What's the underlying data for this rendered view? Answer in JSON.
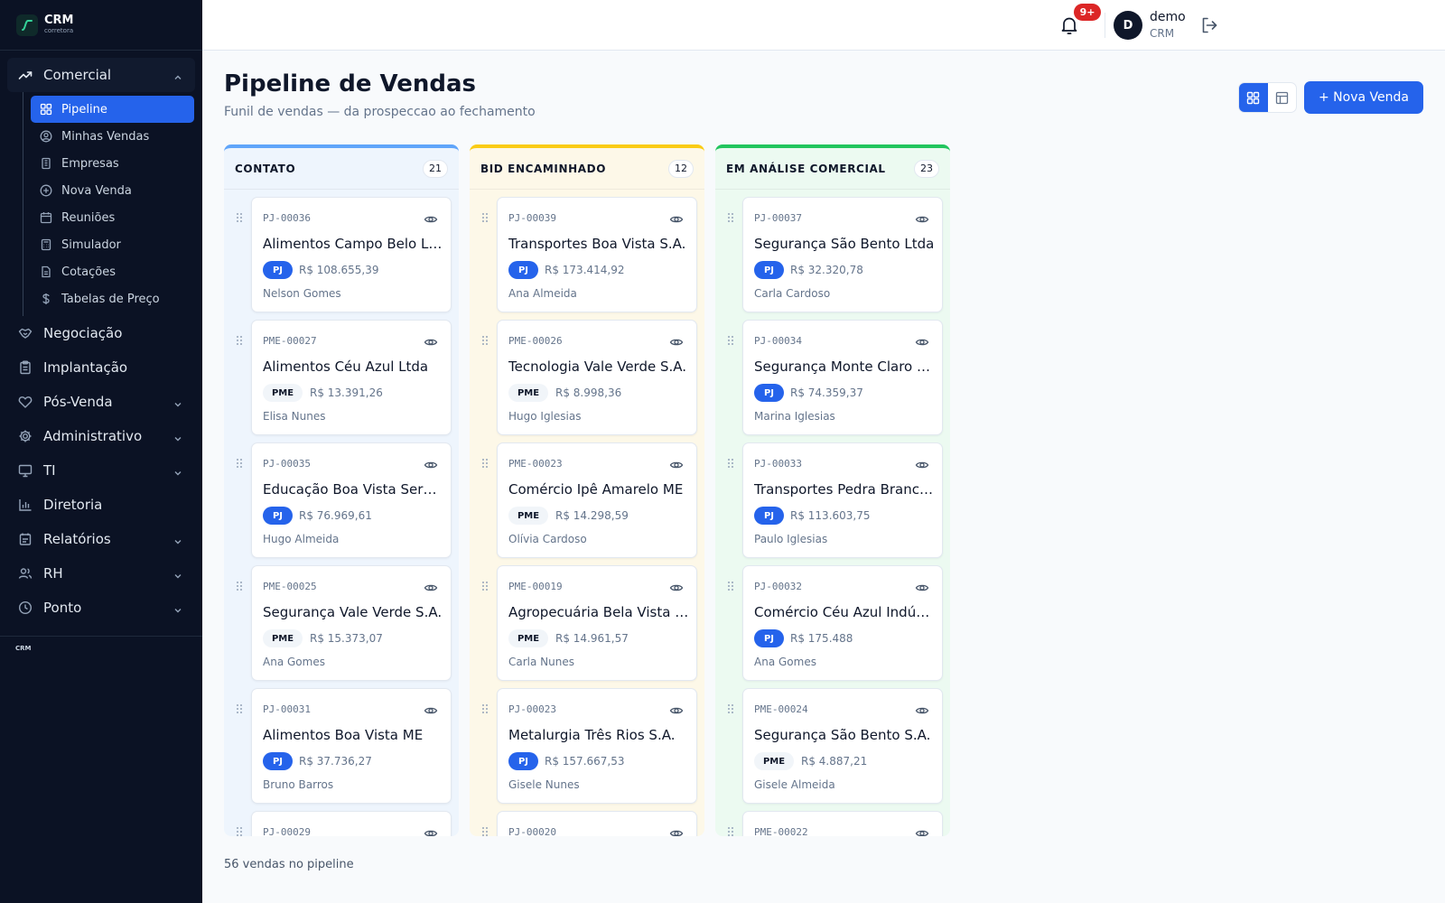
{
  "brand": {
    "title": "CRM",
    "subtitle": "corretora"
  },
  "sidebar": {
    "groups": [
      {
        "label": "Comercial",
        "icon": "trending-up-icon",
        "expanded": true
      },
      {
        "label": "Negociação",
        "icon": "handshake-icon"
      },
      {
        "label": "Implantação",
        "icon": "clipboard-icon"
      },
      {
        "label": "Pós-Venda",
        "icon": "heart-icon"
      },
      {
        "label": "Administrativo",
        "icon": "gear-icon"
      },
      {
        "label": "TI",
        "icon": "monitor-icon"
      },
      {
        "label": "Diretoria",
        "icon": "bar-chart-icon"
      },
      {
        "label": "Relatórios",
        "icon": "document-icon"
      },
      {
        "label": "RH",
        "icon": "users-icon"
      },
      {
        "label": "Ponto",
        "icon": "clock-icon"
      }
    ],
    "comercial_items": [
      {
        "label": "Pipeline",
        "icon": "grid-icon",
        "active": true
      },
      {
        "label": "Minhas Vendas",
        "icon": "user-circle-icon"
      },
      {
        "label": "Empresas",
        "icon": "building-icon"
      },
      {
        "label": "Nova Venda",
        "icon": "plus-circle-icon"
      },
      {
        "label": "Reuniões",
        "icon": "calendar-icon"
      },
      {
        "label": "Simulador",
        "icon": "calculator-icon"
      },
      {
        "label": "Cotações",
        "icon": "file-icon"
      },
      {
        "label": "Tabelas de Preço",
        "icon": "dollar-icon"
      }
    ],
    "footer": "CRM"
  },
  "topbar": {
    "notifications_badge": "9+",
    "avatar_initial": "D",
    "user_name": "demo",
    "user_role": "CRM"
  },
  "header": {
    "title": "Pipeline de Vendas",
    "subtitle": "Funil de vendas — da prospeccao ao fechamento",
    "new_sale_label": "+ Nova Venda",
    "view_mode": "board"
  },
  "columns": [
    {
      "title": "CONTATO",
      "count": "21",
      "color": "#60a5fa",
      "cards": [
        {
          "code": "PJ-00036",
          "name": "Alimentos Campo Belo Ltda",
          "type": "PJ",
          "value": "R$ 108.655,39",
          "owner": "Nelson Gomes"
        },
        {
          "code": "PME-00027",
          "name": "Alimentos Céu Azul Ltda",
          "type": "PME",
          "value": "R$ 13.391,26",
          "owner": "Elisa Nunes"
        },
        {
          "code": "PJ-00035",
          "name": "Educação Boa Vista Servi...",
          "type": "PJ",
          "value": "R$ 76.969,61",
          "owner": "Hugo Almeida"
        },
        {
          "code": "PME-00025",
          "name": "Segurança Vale Verde S.A.",
          "type": "PME",
          "value": "R$ 15.373,07",
          "owner": "Ana Gomes"
        },
        {
          "code": "PJ-00031",
          "name": "Alimentos Boa Vista ME",
          "type": "PJ",
          "value": "R$ 37.736,27",
          "owner": "Bruno Barros"
        },
        {
          "code": "PJ-00029",
          "name": "",
          "type": "",
          "value": "",
          "owner": ""
        }
      ]
    },
    {
      "title": "BID ENCAMINHADO",
      "count": "12",
      "color": "#facc15",
      "cards": [
        {
          "code": "PJ-00039",
          "name": "Transportes Boa Vista S.A.",
          "type": "PJ",
          "value": "R$ 173.414,92",
          "owner": "Ana Almeida"
        },
        {
          "code": "PME-00026",
          "name": "Tecnologia Vale Verde S.A.",
          "type": "PME",
          "value": "R$ 8.998,36",
          "owner": "Hugo Iglesias"
        },
        {
          "code": "PME-00023",
          "name": "Comércio Ipê Amarelo ME",
          "type": "PME",
          "value": "R$ 14.298,59",
          "owner": "Olívia Cardoso"
        },
        {
          "code": "PME-00019",
          "name": "Agropecuária Bela Vista ME",
          "type": "PME",
          "value": "R$ 14.961,57",
          "owner": "Carla Nunes"
        },
        {
          "code": "PJ-00023",
          "name": "Metalurgia Três Rios S.A.",
          "type": "PJ",
          "value": "R$ 157.667,53",
          "owner": "Gisele Nunes"
        },
        {
          "code": "PJ-00020",
          "name": "",
          "type": "",
          "value": "",
          "owner": ""
        }
      ]
    },
    {
      "title": "EM ANÁLISE COMERCIAL",
      "count": "23",
      "color": "#22c55e",
      "cards": [
        {
          "code": "PJ-00037",
          "name": "Segurança São Bento Ltda",
          "type": "PJ",
          "value": "R$ 32.320,78",
          "owner": "Carla Cardoso"
        },
        {
          "code": "PJ-00034",
          "name": "Segurança Monte Claro C...",
          "type": "PJ",
          "value": "R$ 74.359,37",
          "owner": "Marina Iglesias"
        },
        {
          "code": "PJ-00033",
          "name": "Transportes Pedra Branca...",
          "type": "PJ",
          "value": "R$ 113.603,75",
          "owner": "Paulo Iglesias"
        },
        {
          "code": "PJ-00032",
          "name": "Comércio Céu Azul Indúst...",
          "type": "PJ",
          "value": "R$ 175.488",
          "owner": "Ana Gomes"
        },
        {
          "code": "PME-00024",
          "name": "Segurança São Bento S.A.",
          "type": "PME",
          "value": "R$ 4.887,21",
          "owner": "Gisele Almeida"
        },
        {
          "code": "PME-00022",
          "name": "",
          "type": "",
          "value": "",
          "owner": ""
        }
      ]
    }
  ],
  "footer": {
    "pipeline_count": "56 vendas no pipeline"
  }
}
